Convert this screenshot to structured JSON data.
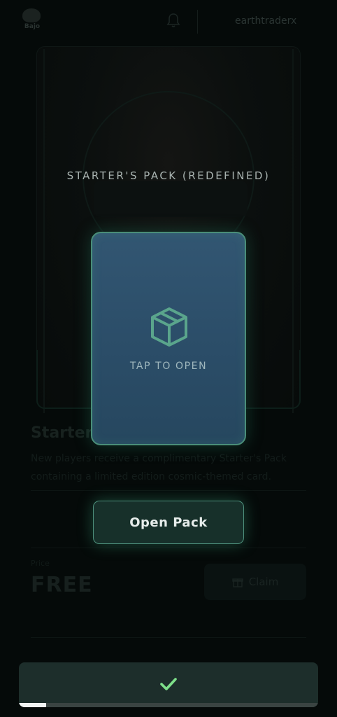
{
  "header": {
    "logo_text": "Bajo",
    "username": "earthtraderx"
  },
  "background": {
    "title": "Starter",
    "description": "New players receive a complimentary Starter's Pack containing a limited edition cosmic-themed card.",
    "price_label": "Price",
    "price_value": "FREE",
    "claim_label": "Claim"
  },
  "overlay": {
    "pack_title": "STARTER'S PACK (REDEFINED)",
    "tap_label": "TAP TO OPEN",
    "open_button_label": "Open Pack"
  },
  "toast": {
    "icon": "check-icon",
    "progress": 0.09
  },
  "colors": {
    "accent_green": "#4a8e79",
    "card_blue": "#2b4d68",
    "check_green": "#7ee08a",
    "background": "#050a09"
  }
}
